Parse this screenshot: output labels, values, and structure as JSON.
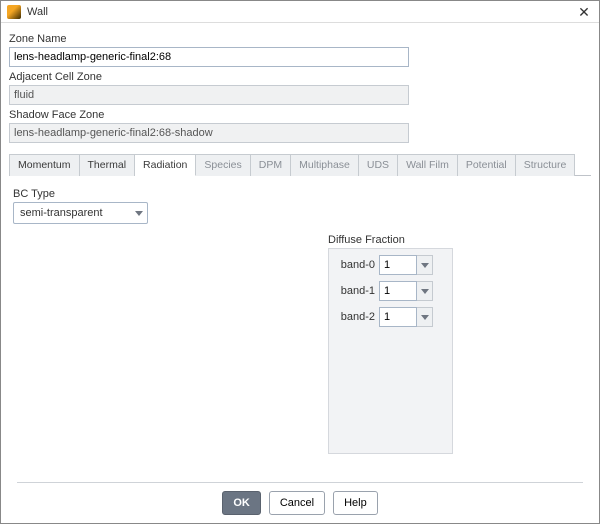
{
  "window": {
    "title": "Wall"
  },
  "zoneName": {
    "label": "Zone Name",
    "value": "lens-headlamp-generic-final2:68"
  },
  "adjacentCellZone": {
    "label": "Adjacent Cell Zone",
    "value": "fluid"
  },
  "shadowFaceZone": {
    "label": "Shadow Face Zone",
    "value": "lens-headlamp-generic-final2:68-shadow"
  },
  "tabs": {
    "momentum": "Momentum",
    "thermal": "Thermal",
    "radiation": "Radiation",
    "species": "Species",
    "dpm": "DPM",
    "multiphase": "Multiphase",
    "uds": "UDS",
    "wallfilm": "Wall Film",
    "potential": "Potential",
    "structure": "Structure"
  },
  "bcType": {
    "label": "BC Type",
    "value": "semi-transparent"
  },
  "diffuse": {
    "header": "Diffuse Fraction",
    "rows": [
      {
        "label": "band-0",
        "value": "1"
      },
      {
        "label": "band-1",
        "value": "1"
      },
      {
        "label": "band-2",
        "value": "1"
      }
    ]
  },
  "buttons": {
    "ok": "OK",
    "cancel": "Cancel",
    "help": "Help"
  }
}
